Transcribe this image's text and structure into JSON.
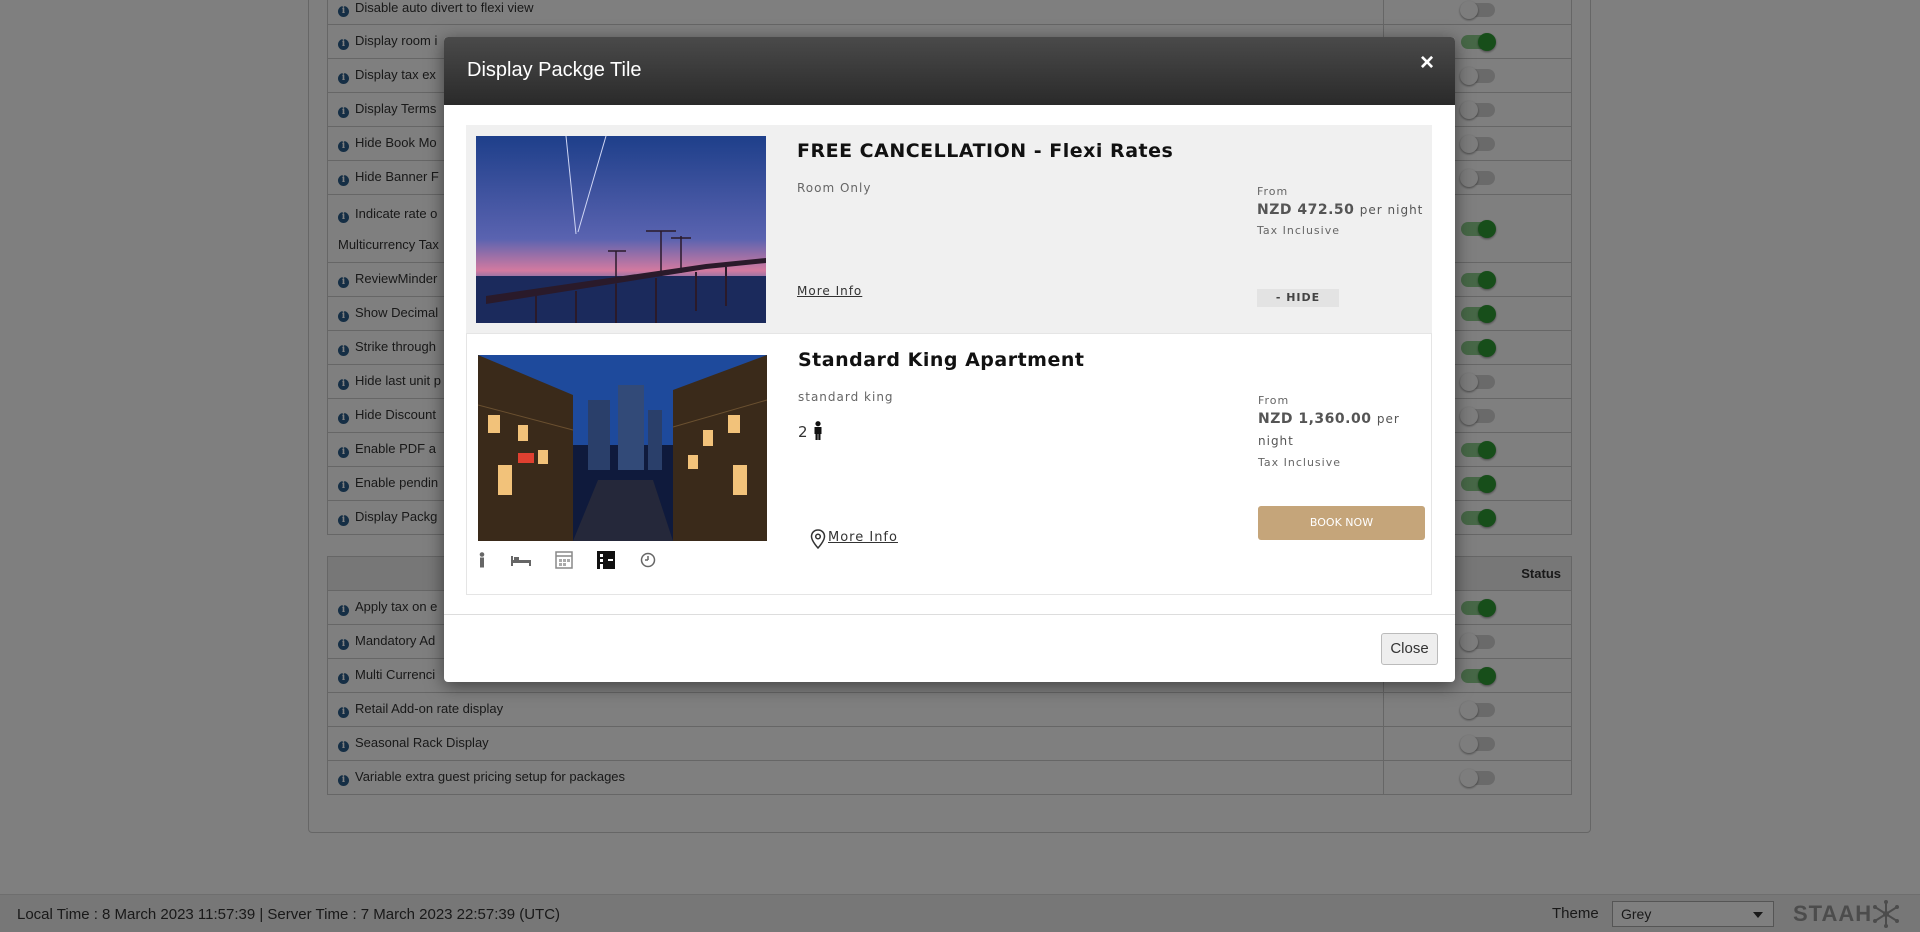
{
  "settings_top": [
    {
      "label": "Disable auto divert to flexi view",
      "on": false
    },
    {
      "label": "Display room i",
      "on": true
    },
    {
      "label": "Display tax ex",
      "on": false
    },
    {
      "label": "Display Terms",
      "on": false
    },
    {
      "label": "Hide Book Mo",
      "on": false
    },
    {
      "label": "Hide Banner F",
      "on": false
    },
    {
      "label": "Indicate rate o",
      "sublabel": "Multicurrency Tax",
      "on": true
    },
    {
      "label": "ReviewMinder",
      "on": true
    },
    {
      "label": "Show Decimal",
      "on": true
    },
    {
      "label": "Strike through",
      "on": true
    },
    {
      "label": "Hide last unit p",
      "on": false
    },
    {
      "label": "Hide Discount",
      "on": false
    },
    {
      "label": "Enable PDF a",
      "on": true
    },
    {
      "label": "Enable pendin",
      "on": true
    },
    {
      "label": "Display Packg",
      "on": true
    }
  ],
  "addon_table": {
    "status_header": "Status",
    "rows": [
      {
        "label": "Apply tax on e",
        "on": true
      },
      {
        "label": "Mandatory Ad",
        "on": false
      },
      {
        "label": "Multi Currenci",
        "on": true
      },
      {
        "label": "Retail Add-on rate display",
        "on": false
      },
      {
        "label": "Seasonal Rack Display",
        "on": false
      },
      {
        "label": "Variable extra guest pricing setup for packages",
        "on": false
      }
    ]
  },
  "footer": {
    "times": "Local Time : 8 March 2023 11:57:39 | Server Time : 7 March 2023 22:57:39 (UTC)",
    "theme_label": "Theme",
    "theme_value": "Grey",
    "logo": "STAAH"
  },
  "modal": {
    "title": "Display Packge Tile",
    "close_x": "×",
    "close_button": "Close",
    "packages": [
      {
        "title": "FREE CANCELLATION - Flexi Rates",
        "subtitle": "Room Only",
        "more_info": "More Info",
        "from": "From",
        "price": "NZD 472.50",
        "per_night": "per night",
        "tax": "Tax Inclusive",
        "action": "- HIDE",
        "image": "pier-at-dusk"
      },
      {
        "title": "Standard King Apartment",
        "subtitle": "standard king",
        "occupancy": "2",
        "more_info": "More Info",
        "from": "From",
        "price": "NZD 1,360.00",
        "per_night": "per night",
        "tax": "Tax Inclusive",
        "action": "BOOK NOW",
        "image": "city-street-night",
        "amenity_icons": [
          "person-icon",
          "bed-icon",
          "calendar-icon",
          "building-icon",
          "clock-icon"
        ]
      }
    ]
  }
}
